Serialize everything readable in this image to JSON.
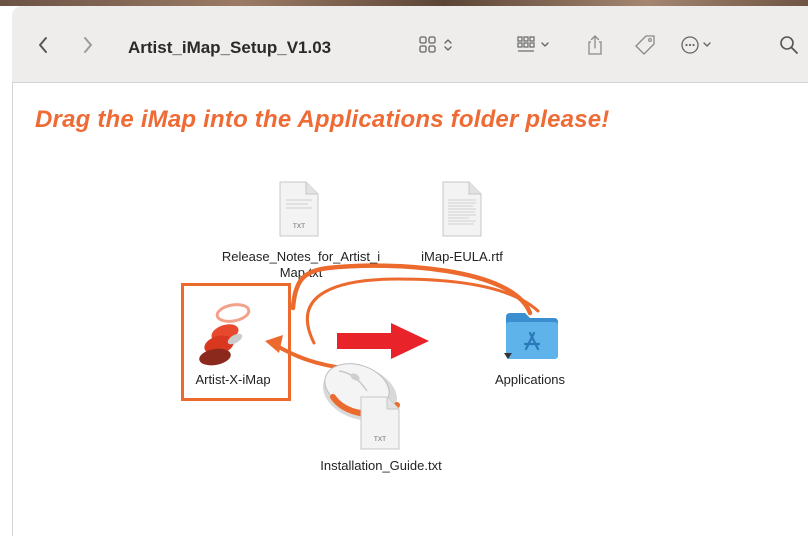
{
  "window": {
    "title": "Artist_iMap_Setup_V1.03",
    "toolbar_icons": [
      "chevron-left-icon",
      "chevron-right-icon",
      "view-grid-icon",
      "group-icon",
      "share-icon",
      "tag-icon",
      "more-icon",
      "search-icon"
    ]
  },
  "content": {
    "instruction": "Drag the iMap into the Applications folder please!",
    "files": {
      "release_notes": {
        "label_line1": "Release_Notes_for_Artist_i",
        "label_line2": "Map.txt",
        "badge": "TXT"
      },
      "eula": {
        "label": "iMap-EULA.rtf"
      },
      "app": {
        "label": "Artist-X-iMap"
      },
      "applications": {
        "label": "Applications"
      },
      "guide": {
        "label": "Installation_Guide.txt",
        "badge": "TXT"
      }
    },
    "colors": {
      "accent": "#ee6b35",
      "arrow": "#e8242a",
      "folder": "#4fa8e2"
    }
  }
}
